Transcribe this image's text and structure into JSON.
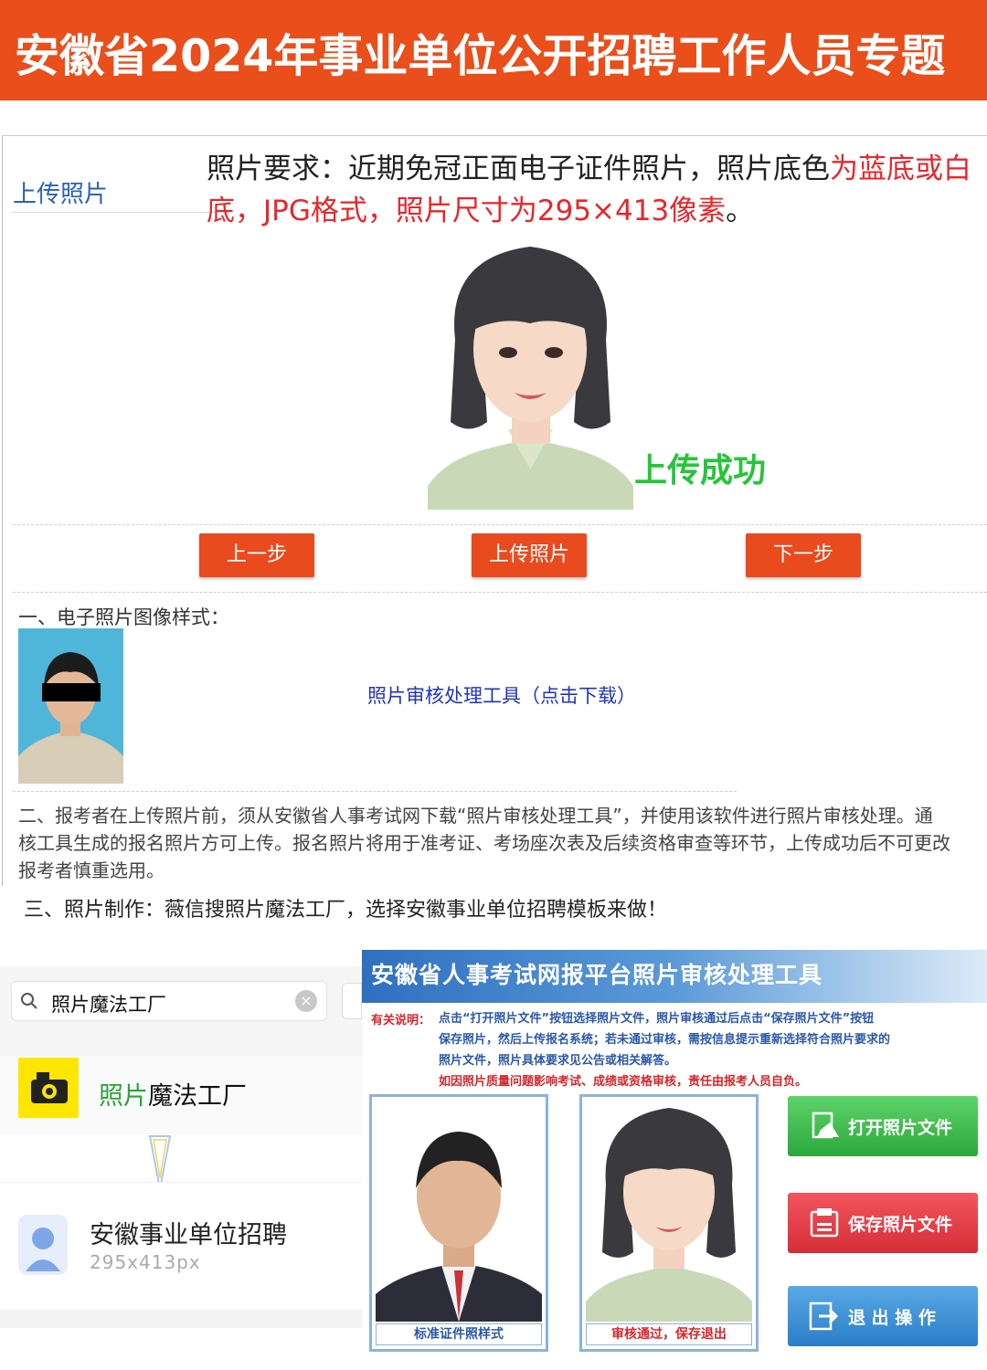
{
  "banner": {
    "title": "安徽省2024年事业单位公开招聘工作人员专题"
  },
  "upload": {
    "label": "上传照片",
    "requirement_black": "照片要求：近期免冠正面电子证件照片，照片底色",
    "requirement_red": "为蓝底或白底，JPG格式，照片尺寸为295×413像素",
    "requirement_end": "。",
    "success": "上传成功",
    "buttons": {
      "prev": "上一步",
      "upload": "上传照片",
      "next": "下一步"
    }
  },
  "section1": {
    "title": "一、电子照片图像样式：",
    "tool_link": "照片审核处理工具（点击下载）"
  },
  "section2": {
    "line1": "二、报考者在上传照片前，须从安徽省人事考试网下载“照片审核处理工具”，并使用该软件进行照片审核处理。通",
    "line2": "核工具生成的报名照片方可上传。报名照片将用于准考证、考场座次表及后续资格审查等环节，上传成功后不可更改",
    "line3": "报考者慎重选用。"
  },
  "section3": {
    "text": "三、照片制作：薇信搜照片魔法工厂，选择安徽事业单位招聘模板来做！"
  },
  "search": {
    "query": "照片魔法工厂",
    "result_green": "照片",
    "result_rest": "魔法工厂",
    "template_name": "安徽事业单位招聘",
    "template_size": "295x413px"
  },
  "tool": {
    "title": "安徽省人事考试网报平台照片审核处理工具",
    "note_label": "有关说明：",
    "note_line1": "点击“打开照片文件”按钮选择照片文件，照片审核通过后点击“保存照片文件”按钮",
    "note_line2": "保存照片，然后上传报名系统；若未通过审核，需按信息提示重新选择符合照片要求的",
    "note_line3": "照片文件，照片具体要求见公告或相关解答。",
    "note_line4": "如因照片质量问题影响考试、成绩或资格审核，责任由报考人员自负。",
    "caption_sample": "标准证件照样式",
    "caption_pass": "审核通过，保存退出",
    "btn_open": "打开照片文件",
    "btn_save": "保存照片文件",
    "btn_exit": "退 出 操 作"
  },
  "colors": {
    "banner": "#e94e1b",
    "button": "#e94b1f",
    "success": "#27c53a",
    "link": "#2135b8",
    "label": "#2a62b6"
  }
}
